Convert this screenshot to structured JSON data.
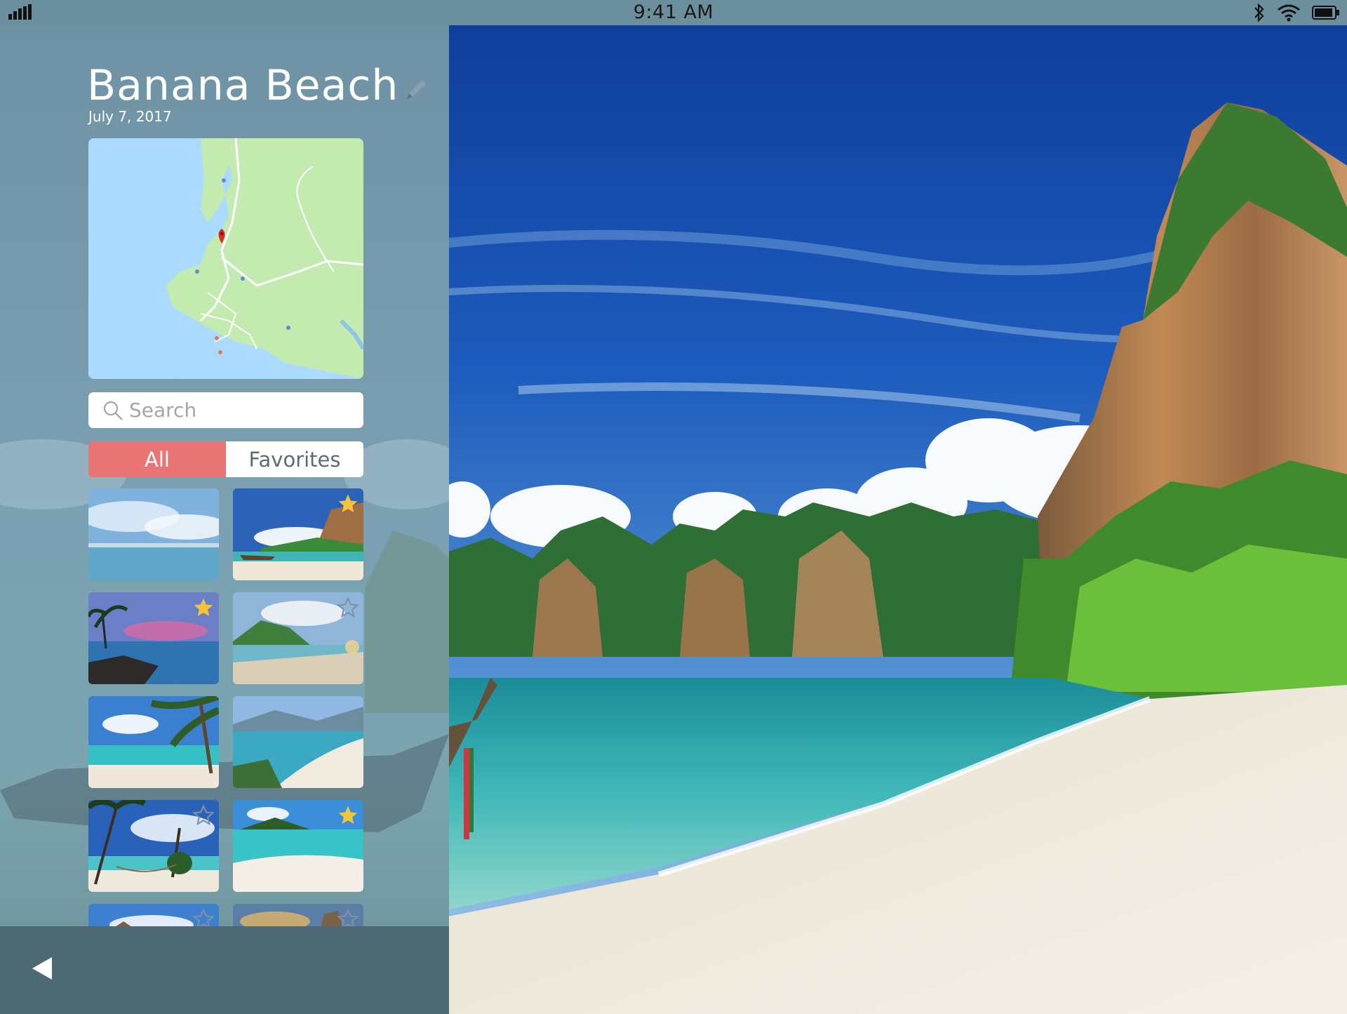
{
  "status_bar": {
    "time": "9:41 AM",
    "icons": [
      "signal-icon",
      "bluetooth-icon",
      "wifi-icon",
      "battery-icon"
    ]
  },
  "place": {
    "title": "Banana Beach",
    "date": "July 7, 2017"
  },
  "search": {
    "placeholder": "Search"
  },
  "filter": {
    "options": [
      "All",
      "Favorites"
    ],
    "selected": "All"
  },
  "thumbnails": [
    {
      "scene": "clouds-sea",
      "favorite": null
    },
    {
      "scene": "beach-boat",
      "favorite": true
    },
    {
      "scene": "sunset-palms",
      "favorite": true
    },
    {
      "scene": "bay-hills",
      "favorite": false
    },
    {
      "scene": "palm-lagoon",
      "favorite": null
    },
    {
      "scene": "aerial-coast",
      "favorite": null
    },
    {
      "scene": "hammock-palms",
      "favorite": false
    },
    {
      "scene": "island-shallows",
      "favorite": true
    },
    {
      "scene": "clouds-rock",
      "favorite": false
    },
    {
      "scene": "golden-rock",
      "favorite": false
    }
  ],
  "colors": {
    "accent": "#e87474",
    "status_bar": "#6b8f9d",
    "sidebar_overlay": "#6d8fa0",
    "bottom_bar": "#4d6a74",
    "star_filled": "#f5c33b"
  }
}
